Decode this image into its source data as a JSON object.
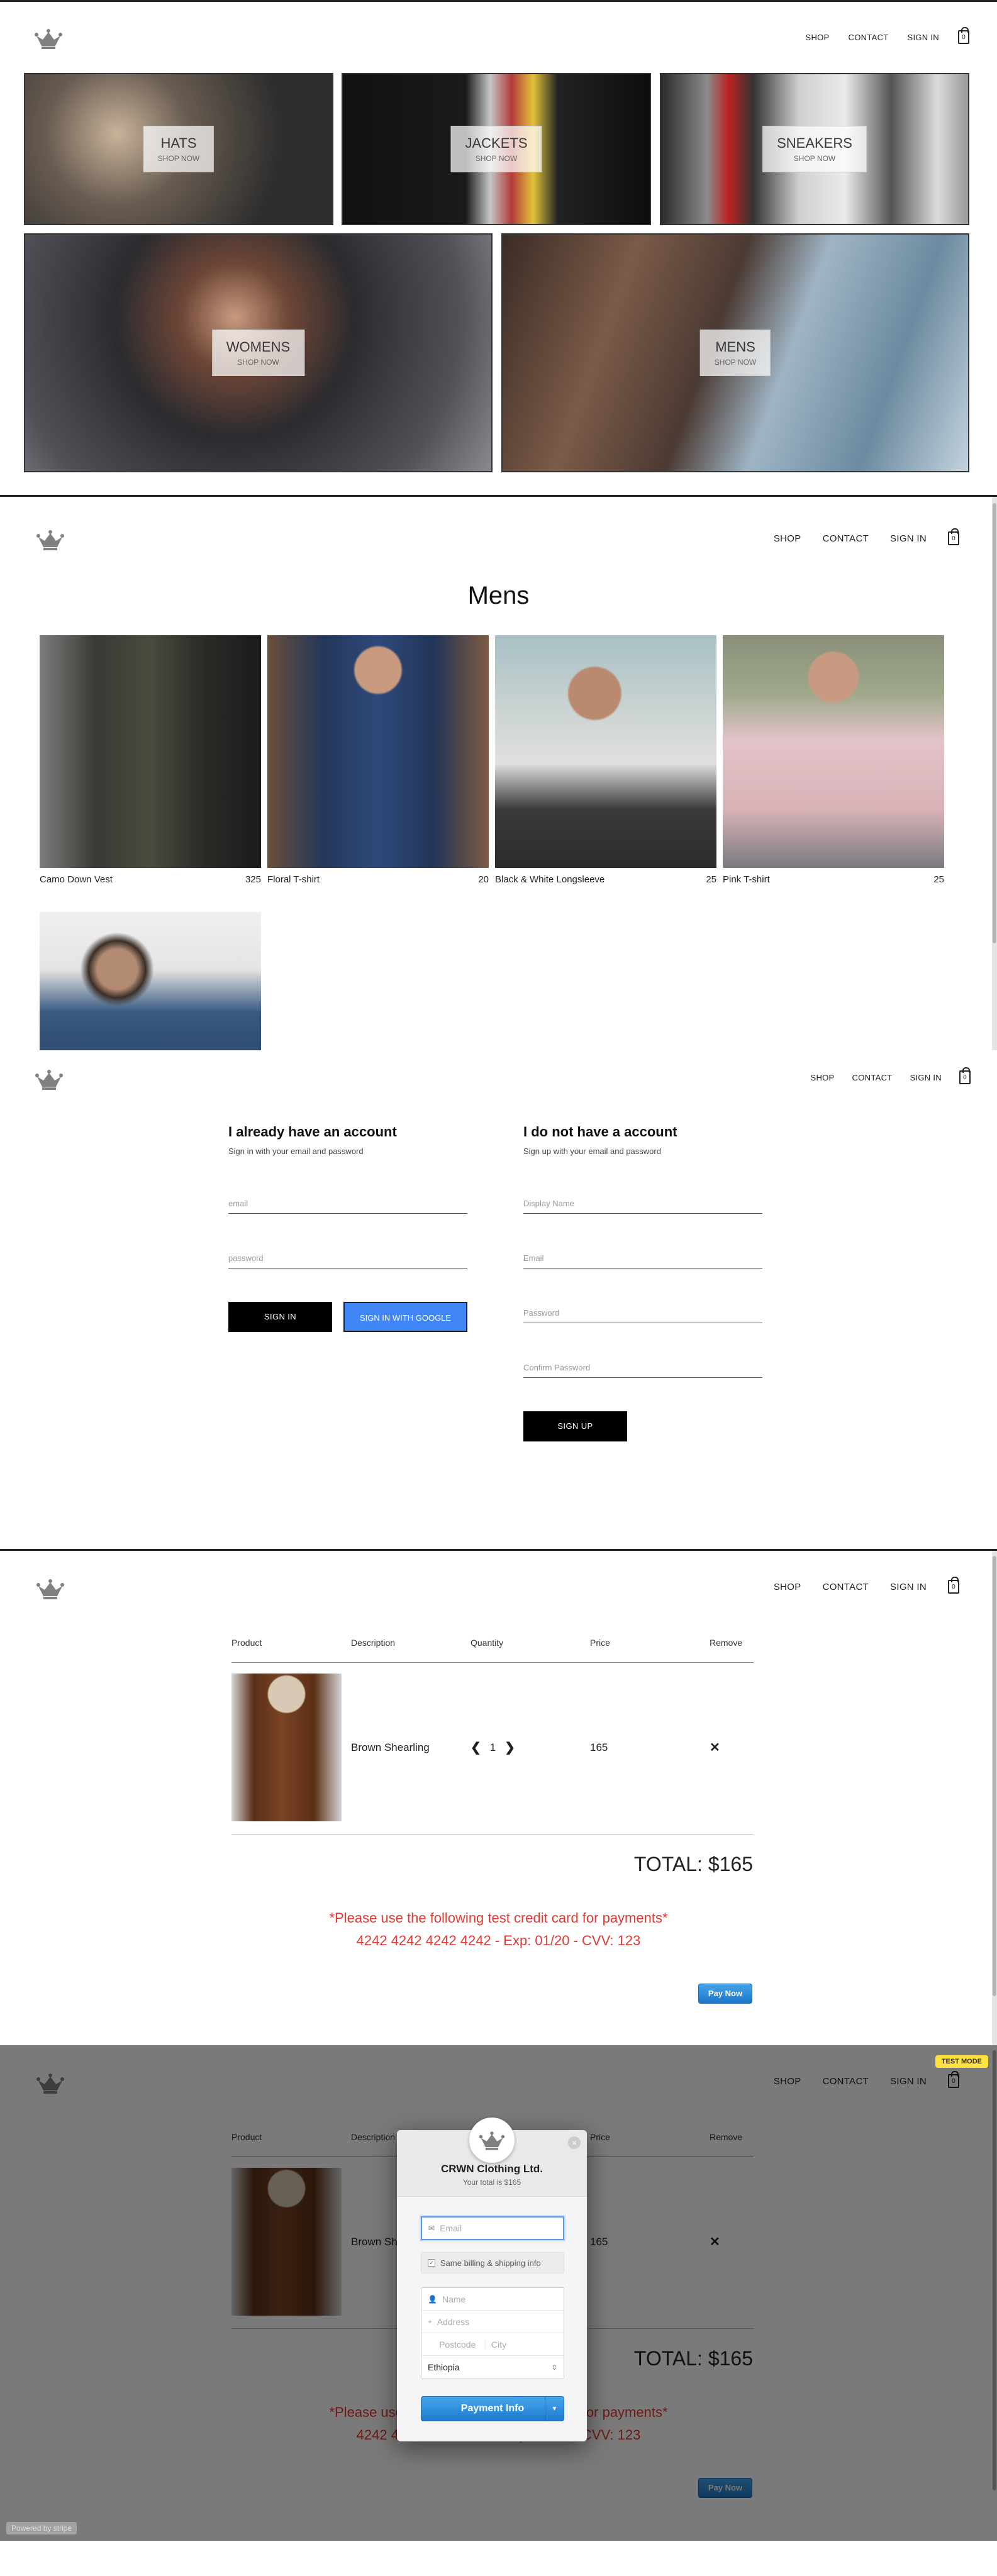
{
  "nav": {
    "shop": "SHOP",
    "contact": "CONTACT",
    "sign_in": "SIGN IN",
    "cart_count": "0"
  },
  "directory": {
    "tiles": [
      {
        "title": "HATS",
        "subtitle": "SHOP NOW"
      },
      {
        "title": "JACKETS",
        "subtitle": "SHOP NOW"
      },
      {
        "title": "SNEAKERS",
        "subtitle": "SHOP NOW"
      },
      {
        "title": "WOMENS",
        "subtitle": "SHOP NOW"
      },
      {
        "title": "MENS",
        "subtitle": "SHOP NOW"
      }
    ]
  },
  "collection": {
    "title": "Mens",
    "items": [
      {
        "name": "Camo Down Vest",
        "price": "325"
      },
      {
        "name": "Floral T-shirt",
        "price": "20"
      },
      {
        "name": "Black & White Longsleeve",
        "price": "25"
      },
      {
        "name": "Pink T-shirt",
        "price": "25"
      },
      {
        "name": "",
        "price": ""
      }
    ]
  },
  "auth": {
    "signin": {
      "heading": "I already have an account",
      "subheading": "Sign in with your email and password",
      "email_placeholder": "email",
      "password_placeholder": "password",
      "signin_button": "SIGN IN",
      "google_button": "SIGN IN WITH GOOGLE"
    },
    "signup": {
      "heading": "I do not have a account",
      "subheading": "Sign up with your email and password",
      "display_name_placeholder": "Display Name",
      "email_placeholder": "Email",
      "password_placeholder": "Password",
      "confirm_placeholder": "Confirm Password",
      "signup_button": "SIGN UP"
    }
  },
  "checkout": {
    "headers": [
      "Product",
      "Description",
      "Quantity",
      "Price",
      "Remove"
    ],
    "item": {
      "description": "Brown Shearling",
      "quantity": "1",
      "price": "165",
      "remove": "✕",
      "dec": "❮",
      "inc": "❯"
    },
    "total": "TOTAL: $165",
    "warning_line1": "*Please use the following test credit card for payments*",
    "warning_line2": "4242 4242 4242 4242 - Exp: 01/20 - CVV: 123",
    "pay_button": "Pay Now"
  },
  "stripe_modal": {
    "company": "CRWN Clothing Ltd.",
    "subtitle": "Your total is $165",
    "email_placeholder": "Email",
    "same_billing": "Same billing & shipping info",
    "name_placeholder": "Name",
    "address_placeholder": "Address",
    "postcode_placeholder": "Postcode",
    "city_placeholder": "City",
    "country": "Ethiopia",
    "pay_button": "Payment Info",
    "test_mode": "TEST MODE",
    "powered_by": "Powered by stripe",
    "close": "×"
  },
  "colors": {
    "accent_blue": "#4285f4",
    "warning_red": "#e53935",
    "stripe_blue": "#1c7bd0",
    "test_yellow": "#ffe23b"
  },
  "icons": [
    "crown-logo-icon",
    "shopping-bag-icon",
    "close-icon",
    "email-icon",
    "checkbox-icon",
    "user-icon",
    "location-pin-icon",
    "chevron-updown-icon",
    "chevron-down-icon",
    "chevron-left-icon",
    "chevron-right-icon"
  ]
}
